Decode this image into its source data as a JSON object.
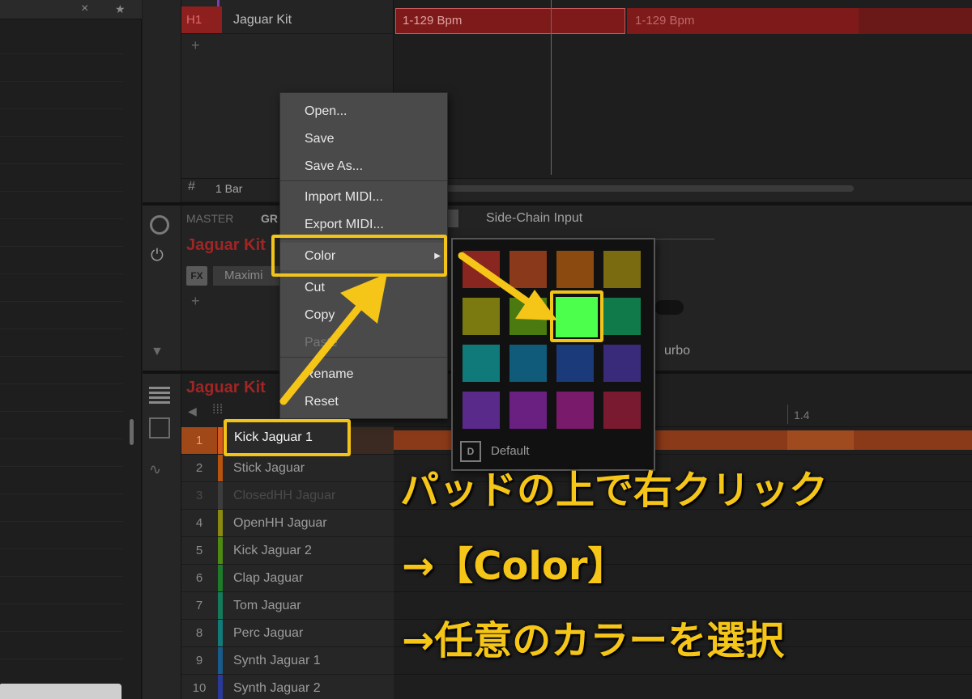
{
  "browser": {
    "close_icon": "×",
    "star_icon": "★"
  },
  "arranger": {
    "scene": {
      "tag": "H1",
      "name": "Jaguar Kit"
    },
    "add_scene": "+",
    "clips": [
      "1-129 Bpm",
      "1-129 Bpm"
    ],
    "bar_icon": "#",
    "bar_label": "1 Bar"
  },
  "control": {
    "tabs": {
      "master": "MASTER",
      "group": "GR",
      "sidechain": "Side-Chain Input"
    },
    "title": "Jaguar Kit",
    "fx_label": "FX",
    "plugin_slot": "Maximi",
    "add_slot": "+",
    "turbo_label": "urbo"
  },
  "pattern": {
    "title": "Jaguar Kit",
    "ruler_label": "1.4",
    "pads": [
      {
        "num": "1",
        "label": "Kick Jaguar 1",
        "color": "#d65a1e"
      },
      {
        "num": "2",
        "label": "Stick Jaguar",
        "color": "#b8520f"
      },
      {
        "num": "3",
        "label": "ClosedHH Jaguar",
        "color": "#3d3d3d"
      },
      {
        "num": "4",
        "label": "OpenHH Jaguar",
        "color": "#8a8a10"
      },
      {
        "num": "5",
        "label": "Kick Jaguar 2",
        "color": "#4e8a12"
      },
      {
        "num": "6",
        "label": "Clap Jaguar",
        "color": "#1f7a2a"
      },
      {
        "num": "7",
        "label": "Tom Jaguar",
        "color": "#157a5a"
      },
      {
        "num": "8",
        "label": "Perc Jaguar",
        "color": "#137a7a"
      },
      {
        "num": "9",
        "label": "Synth Jaguar 1",
        "color": "#1a5a8a"
      },
      {
        "num": "10",
        "label": "Synth Jaguar 2",
        "color": "#2a3a9a"
      }
    ]
  },
  "context_menu": {
    "items": [
      "Open...",
      "Save",
      "Save As...",
      "Import MIDI...",
      "Export MIDI...",
      "Color",
      "Cut",
      "Copy",
      "Paste",
      "Rename",
      "Reset"
    ],
    "submenu_arrow": "▶"
  },
  "color_submenu": {
    "swatches": [
      "#8a2620",
      "#8a3a1a",
      "#8a4a10",
      "#7a6a10",
      "#7a7a10",
      "#4a7a10",
      "#4cff4c",
      "#107a4a",
      "#107a7a",
      "#105a7a",
      "#1a3a7a",
      "#3a2a7a",
      "#5a2a8a",
      "#6a2080",
      "#7a1a6a",
      "#7a1a30"
    ],
    "default_icon": "D",
    "default_label": "Default"
  },
  "annotation": {
    "line1": "パッドの上で右クリック",
    "line2": "→【Color】",
    "line3": "→任意のカラーを選択",
    "accent": "#f2c419"
  }
}
